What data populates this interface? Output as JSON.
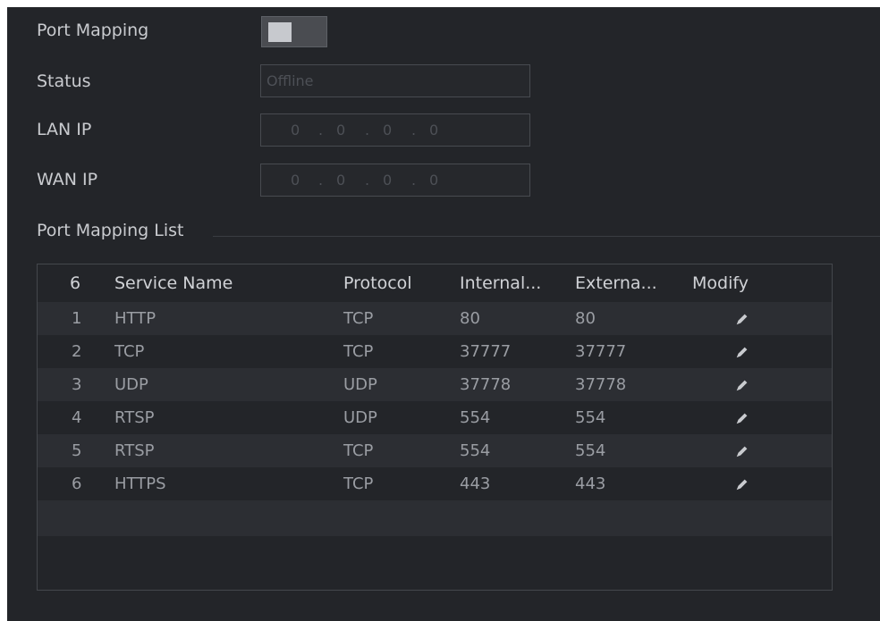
{
  "port_mapping": {
    "label": "Port Mapping",
    "enabled": false
  },
  "status": {
    "label": "Status",
    "value": "Offline"
  },
  "lan_ip": {
    "label": "LAN IP",
    "octets": [
      "0",
      "0",
      "0",
      "0"
    ]
  },
  "wan_ip": {
    "label": "WAN IP",
    "octets": [
      "0",
      "0",
      "0",
      "0"
    ]
  },
  "list": {
    "title": "Port Mapping List",
    "columns": {
      "count": "6",
      "service_name": "Service Name",
      "protocol": "Protocol",
      "internal": "Internal...",
      "external": "Externa...",
      "modify": "Modify"
    },
    "rows": [
      {
        "no": "1",
        "service": "HTTP",
        "protocol": "TCP",
        "internal": "80",
        "external": "80"
      },
      {
        "no": "2",
        "service": "TCP",
        "protocol": "TCP",
        "internal": "37777",
        "external": "37777"
      },
      {
        "no": "3",
        "service": "UDP",
        "protocol": "UDP",
        "internal": "37778",
        "external": "37778"
      },
      {
        "no": "4",
        "service": "RTSP",
        "protocol": "UDP",
        "internal": "554",
        "external": "554"
      },
      {
        "no": "5",
        "service": "RTSP",
        "protocol": "TCP",
        "internal": "554",
        "external": "554"
      },
      {
        "no": "6",
        "service": "HTTPS",
        "protocol": "TCP",
        "internal": "443",
        "external": "443"
      }
    ]
  },
  "icons": {
    "modify": "pencil-icon"
  }
}
